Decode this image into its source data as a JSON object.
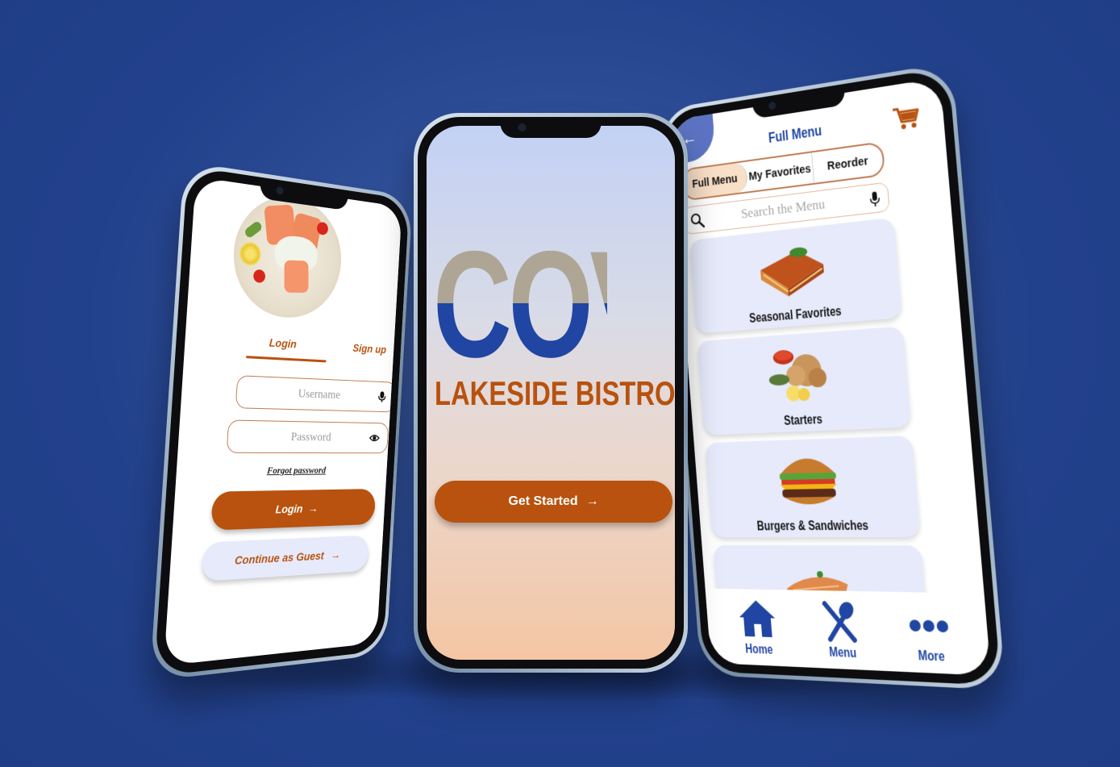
{
  "login_screen": {
    "tabs": {
      "login": "Login",
      "signup": "Sign up"
    },
    "username_placeholder": "Username",
    "password_placeholder": "Password",
    "forgot_password": "Forgot password",
    "login_button": "Login",
    "guest_button": "Continue as Guest",
    "arrow": "→"
  },
  "splash_screen": {
    "logo_text": "COVE",
    "subtitle": "LAKESIDE BISTRO",
    "get_started": "Get Started",
    "arrow": "→"
  },
  "menu_screen": {
    "back_icon": "←",
    "title": "Full Menu",
    "segments": [
      "Full Menu",
      "My Favorites",
      "Reorder"
    ],
    "active_segment": "Full Menu",
    "search_placeholder": "Search the Menu",
    "categories": [
      {
        "label": "Seasonal Favorites",
        "icon": "lasagna-image"
      },
      {
        "label": "Starters",
        "icon": "calamari-image"
      },
      {
        "label": "Burgers & Sandwiches",
        "icon": "burger-image"
      },
      {
        "label": "",
        "icon": "salmon-image"
      }
    ],
    "nav": [
      {
        "label": "Home",
        "icon": "home-icon"
      },
      {
        "label": "Menu",
        "icon": "fork-knife-icon"
      },
      {
        "label": "More",
        "icon": "more-dots-icon"
      }
    ]
  },
  "colors": {
    "background": "#23428c",
    "brand_orange": "#b8520e",
    "brand_blue": "#2045a2",
    "logo_taupe": "#aea595",
    "card_lavender": "#e6eafb"
  }
}
